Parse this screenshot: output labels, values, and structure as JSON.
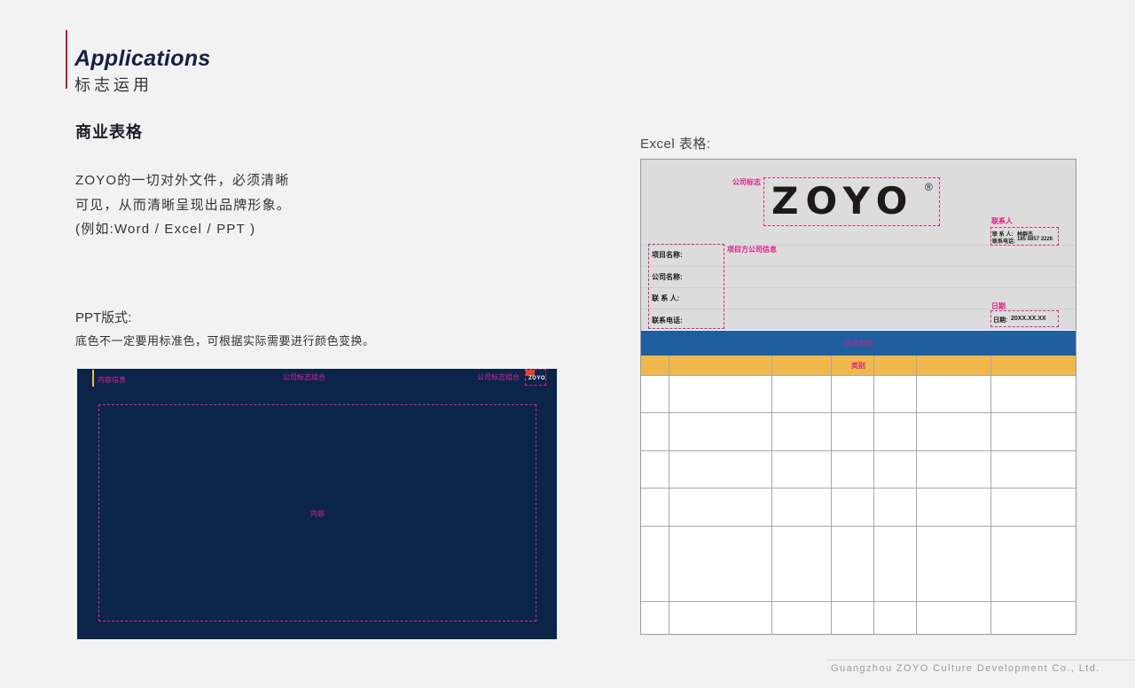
{
  "header": {
    "title_en": "Applications",
    "title_cn": "标志运用"
  },
  "section": {
    "heading": "商业表格",
    "body_lines": [
      "ZOYO的一切对外文件，必须清晰",
      "可见，从而清晰呈现出品牌形象。",
      "(例如:Word / Excel / PPT )"
    ]
  },
  "ppt": {
    "label": "PPT版式:",
    "note": "底色不一定要用标准色，可根据实际需要进行颜色变换。",
    "content_info": "内容信息",
    "logo_combo_center": "公司标志组合",
    "logo_combo_right": "公司标志组合",
    "mini_logo": "ZOYO",
    "content": "内容",
    "colors": {
      "background": "#0b2549",
      "annotation": "#e0208a"
    }
  },
  "excel": {
    "label": "Excel 表格:",
    "company_logo_label": "公司标志",
    "logo_text": "ZOYO",
    "registered_mark": "®",
    "contact_title": "联系人",
    "contact_name_label": "联 系 人:",
    "contact_name": "林群杰",
    "contact_phone_label": "联系电话:",
    "contact_phone": "185 8857 2226",
    "project_info_title": "项目方公司信息",
    "fields": [
      "项目名称:",
      "公司名称:",
      "联 系 人:",
      "联系电话:"
    ],
    "date_title": "日期",
    "date_label": "日期:",
    "date_value": "20XX.XX.XX",
    "project_content": "项目内容",
    "category": "类别",
    "colors": {
      "header_bg": "#dcdcdc",
      "blue_row": "#1f5fa0",
      "yellow_row": "#f0b84a"
    }
  },
  "footer": {
    "company": "Guangzhou ZOYO Culture Development Co., Ltd."
  }
}
